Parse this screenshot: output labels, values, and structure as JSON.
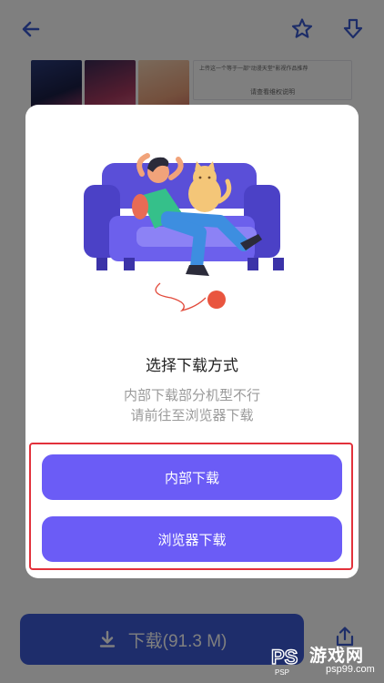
{
  "colors": {
    "accent": "#6b5cf6",
    "primary_download": "#3d5bd6",
    "highlight": "#e2313b",
    "icon_blue": "#3a5bd0"
  },
  "topbar": {
    "back_icon": "arrow-left-icon",
    "favorite_icon": "star-outline-icon",
    "download_icon": "arrow-down-icon"
  },
  "background": {
    "notice_text": "上传这一个等于一部\"动漫天堂\"影视作品推荐",
    "notice_sub": "请查看维权说明"
  },
  "dialog": {
    "illustration_icon": "person-on-sofa-with-cat-illustration",
    "title": "选择下载方式",
    "desc_line1": "内部下载部分机型不行",
    "desc_line2": "请前往至浏览器下载",
    "internal_button": "内部下载",
    "browser_button": "浏览器下载"
  },
  "bottom_bar": {
    "download_label": "下载(91.3 M)",
    "download_icon": "download-icon",
    "share_icon": "share-icon"
  },
  "watermark": {
    "logo": "PSP",
    "title": "游戏网",
    "url": "psp99.com"
  }
}
